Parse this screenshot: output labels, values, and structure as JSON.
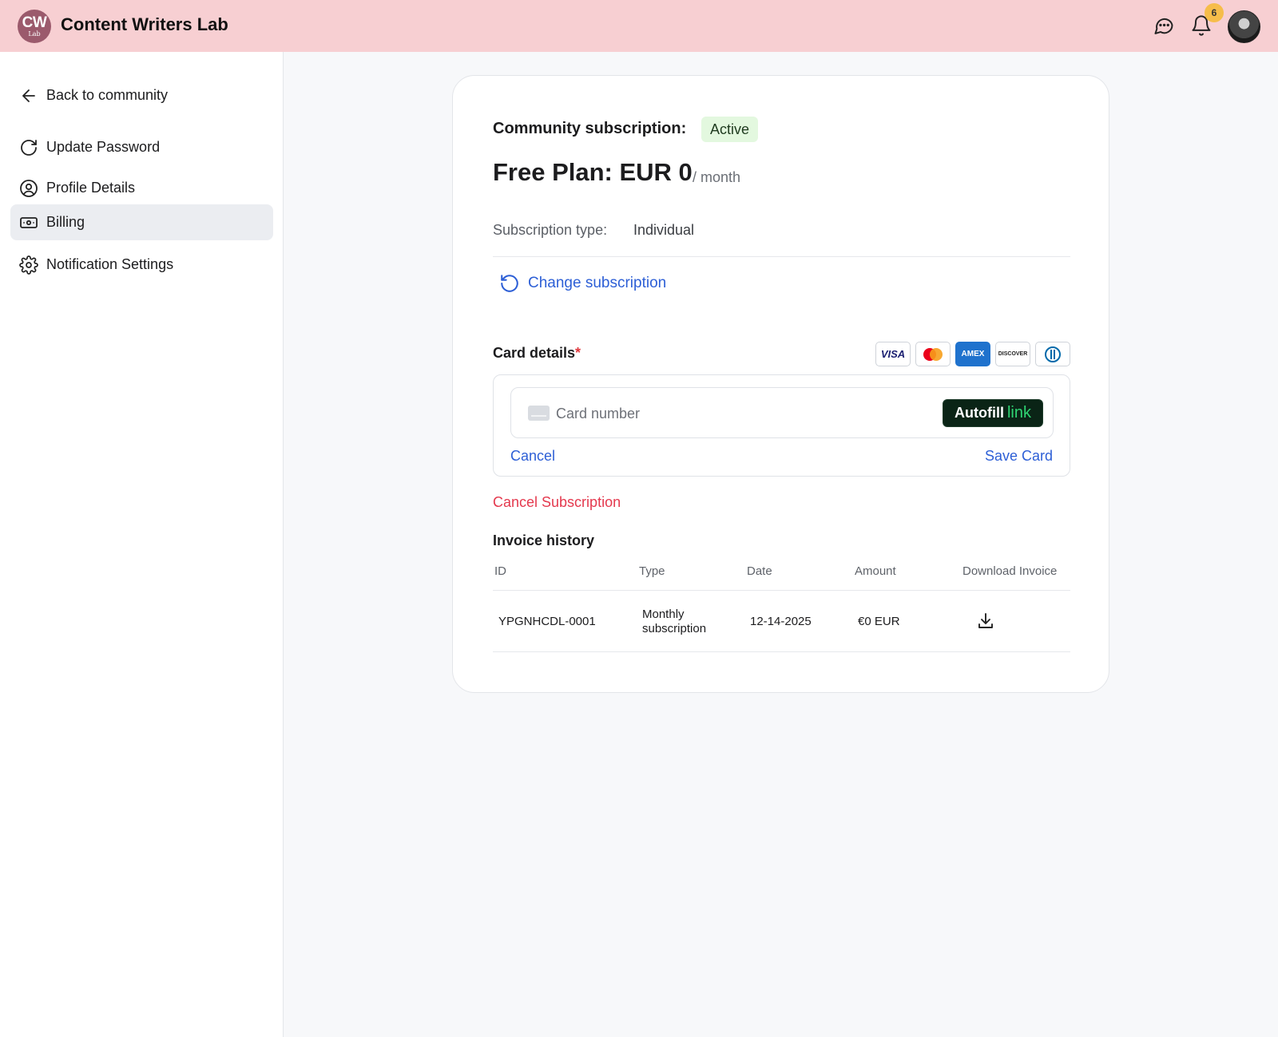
{
  "header": {
    "logo_text": "CW",
    "logo_subtext": "Lab",
    "app_title": "Content Writers Lab",
    "notification_count": "6",
    "icons": [
      "chat-icon",
      "bell-icon"
    ]
  },
  "sidebar": {
    "back_label": "Back to community",
    "items": [
      {
        "label": "Update Password",
        "icon": "refresh-icon"
      },
      {
        "label": "Profile Details",
        "icon": "user-circle-icon"
      },
      {
        "label": "Billing",
        "icon": "banknote-icon",
        "active": true
      },
      {
        "label": "Notification Settings",
        "icon": "gear-icon"
      }
    ]
  },
  "subscription": {
    "label": "Community subscription:",
    "status": "Active",
    "plan": "Free Plan: EUR 0",
    "period": "/ month",
    "type_label": "Subscription type:",
    "type_value": "Individual",
    "change_label": "Change subscription"
  },
  "card": {
    "label": "Card details",
    "required_mark": "*",
    "brands": [
      "VISA",
      "Mastercard",
      "AMEX",
      "DISCOVER",
      "Diners"
    ],
    "number_placeholder": "Card number",
    "autofill_label": "Autofill",
    "autofill_link": "link",
    "cancel_label": "Cancel",
    "save_label": "Save Card",
    "cancel_subscription_label": "Cancel Subscription"
  },
  "invoices": {
    "title": "Invoice history",
    "columns": [
      "ID",
      "Type",
      "Date",
      "Amount",
      "Download Invoice"
    ],
    "rows": [
      {
        "id": "YPGNHCDL-0001",
        "type_line1": "Monthly",
        "type_line2": "subscription",
        "date": "12-14-2025",
        "amount": "€0 EUR"
      }
    ]
  },
  "colors": {
    "header_bg": "#f7cfd2",
    "accent_link": "#2d5fd6",
    "danger": "#e4394e",
    "active_badge_bg": "#e3f8df"
  }
}
